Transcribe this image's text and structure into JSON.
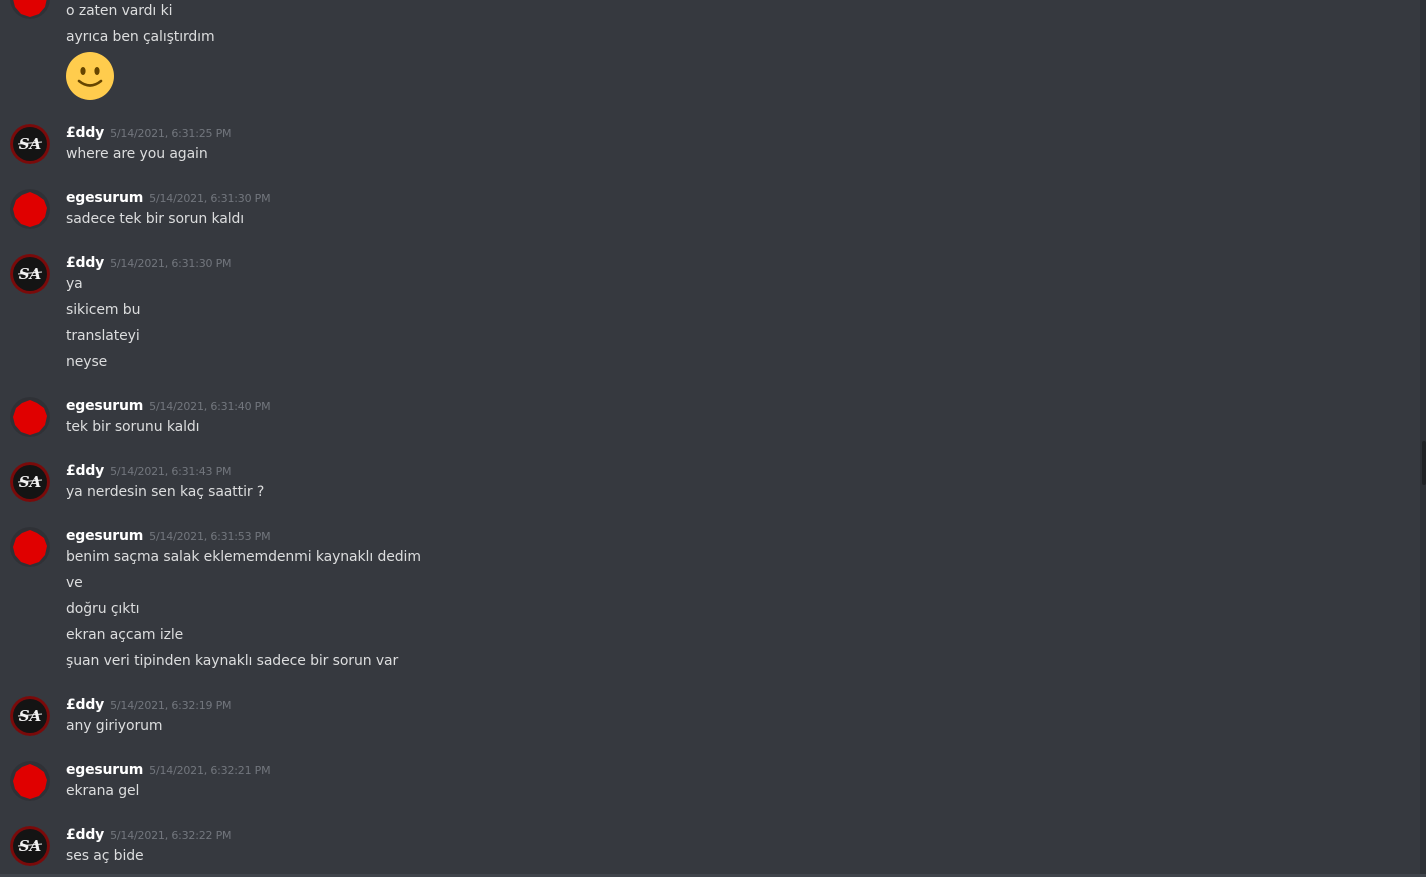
{
  "users": {
    "eddy": {
      "name": "£ddy",
      "avatar_icon": "sa-logo-avatar"
    },
    "ege": {
      "name": "egesurum",
      "avatar_icon": "red-blob-avatar"
    }
  },
  "messages": {
    "m0": {
      "lines": [
        "o zaten vardı ki",
        "ayrıca ben çalıştırdım"
      ],
      "emoji": "slightly-smiling-face-icon"
    },
    "m1": {
      "author": "£ddy",
      "time": "5/14/2021, 6:31:25 PM",
      "lines": [
        "where are you again"
      ]
    },
    "m2": {
      "author": "egesurum",
      "time": "5/14/2021, 6:31:30 PM",
      "lines": [
        "sadece tek bir sorun kaldı"
      ]
    },
    "m3": {
      "author": "£ddy",
      "time": "5/14/2021, 6:31:30 PM",
      "lines": [
        "ya",
        "sikicem bu",
        "translateyi",
        "neyse"
      ]
    },
    "m4": {
      "author": "egesurum",
      "time": "5/14/2021, 6:31:40 PM",
      "lines": [
        "tek bir sorunu kaldı"
      ]
    },
    "m5": {
      "author": "£ddy",
      "time": "5/14/2021, 6:31:43 PM",
      "lines": [
        "ya nerdesin sen kaç saattir ?"
      ]
    },
    "m6": {
      "author": "egesurum",
      "time": "5/14/2021, 6:31:53 PM",
      "lines": [
        "benim saçma salak eklememdenmi kaynaklı dedim",
        "ve",
        "doğru çıktı",
        "ekran açcam izle",
        "şuan veri tipinden kaynaklı sadece bir sorun var"
      ]
    },
    "m7": {
      "author": "£ddy",
      "time": "5/14/2021, 6:32:19 PM",
      "lines": [
        "any giriyorum"
      ]
    },
    "m8": {
      "author": "egesurum",
      "time": "5/14/2021, 6:32:21 PM",
      "lines": [
        "ekrana gel"
      ]
    },
    "m9": {
      "author": "£ddy",
      "time": "5/14/2021, 6:32:22 PM",
      "lines": [
        "ses aç bide"
      ]
    }
  },
  "colors": {
    "background": "#36393f",
    "username": "#ffffff",
    "timestamp": "#72767d",
    "text": "#dcddde",
    "ege_avatar": "#e00000",
    "eddy_avatar_ring": "#7a0a0a"
  }
}
